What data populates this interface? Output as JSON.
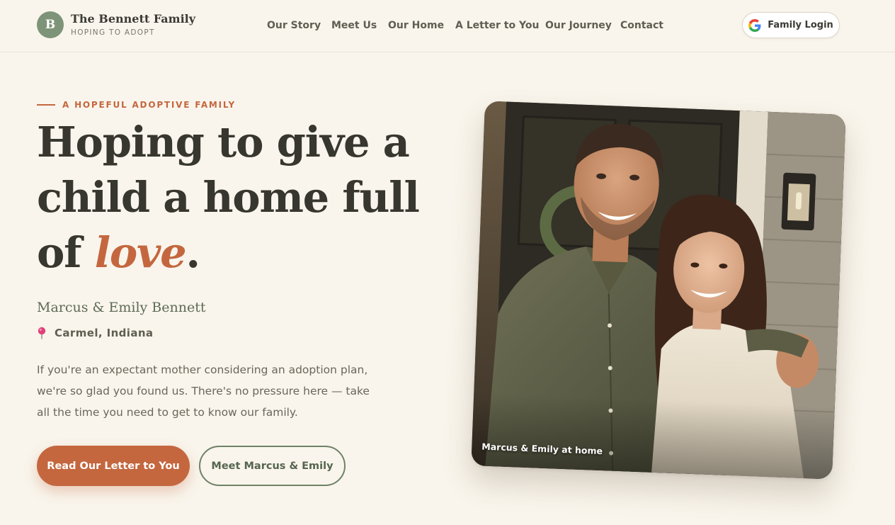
{
  "brand": {
    "initial": "B",
    "name": "The Bennett Family",
    "tagline": "HOPING TO ADOPT"
  },
  "nav": {
    "items": [
      {
        "label": "Our Story"
      },
      {
        "label": "Meet Us"
      },
      {
        "label": "Our Home"
      },
      {
        "label": "A Letter to You"
      },
      {
        "label": "Our Journey"
      },
      {
        "label": "Contact"
      }
    ]
  },
  "login": {
    "label": "Family Login",
    "icon": "google-icon"
  },
  "hero": {
    "eyebrow": "A HOPEFUL ADOPTIVE FAMILY",
    "headline_part1": "Hoping to give a child a home full of ",
    "headline_accent": "love",
    "headline_end": ".",
    "names": "Marcus & Emily Bennett",
    "location": "Carmel, Indiana",
    "location_icon": "map-pin-icon",
    "intro": "If you're an expectant mother considering an adoption plan, we're so glad you found us. There's no pressure here — take all the time you need to get to know our family.",
    "primary_cta": "Read Our Letter to You",
    "secondary_cta": "Meet Marcus & Emily",
    "photo_caption": "Marcus & Emily at home"
  },
  "colors": {
    "background": "#f9f5ec",
    "accent": "#c4673f",
    "sage": "#7e9478",
    "text_dark": "#38372f"
  }
}
